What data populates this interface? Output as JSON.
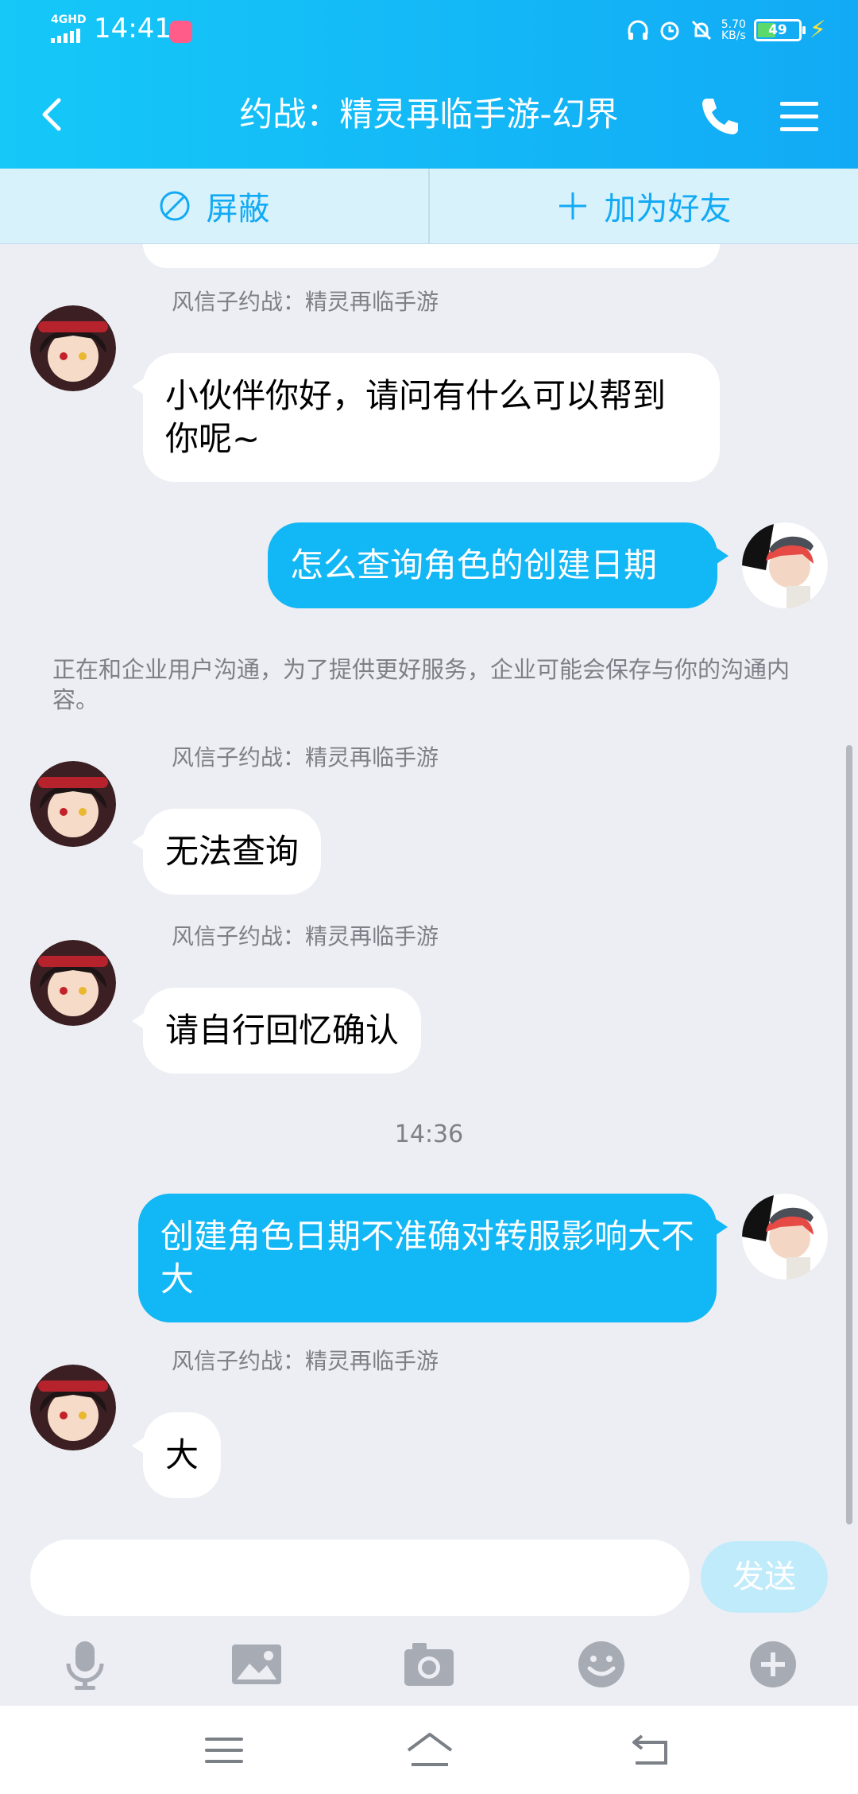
{
  "status_bar": {
    "network": "4GHD",
    "time": "14:41",
    "speed_value": "5.70",
    "speed_unit": "KB/s",
    "battery": "49",
    "battery_level": 0.49
  },
  "header": {
    "title": "约战：精灵再临手游-幻界"
  },
  "actions": {
    "block_label": "屏蔽",
    "add_friend_label": "加为好友"
  },
  "messages": [
    {
      "type": "incoming",
      "sender": "风信子约战：精灵再临手游",
      "text": "小伙伴你好，请问有什么可以帮到你呢~"
    },
    {
      "type": "outgoing",
      "text": "怎么查询角色的创建日期"
    },
    {
      "type": "notice",
      "text": "正在和企业用户沟通，为了提供更好服务，企业可能会保存与你的沟通内容。"
    },
    {
      "type": "incoming",
      "sender": "风信子约战：精灵再临手游",
      "text": "无法查询"
    },
    {
      "type": "incoming",
      "sender": "风信子约战：精灵再临手游",
      "text": "请自行回忆确认"
    },
    {
      "type": "time",
      "text": "14:36"
    },
    {
      "type": "outgoing",
      "text": "创建角色日期不准确对转服影响大不大"
    },
    {
      "type": "incoming",
      "sender": "风信子约战：精灵再临手游",
      "text": "大"
    }
  ],
  "input": {
    "placeholder": "",
    "send_label": "发送"
  },
  "colors": {
    "accent": "#12b7f5",
    "header_gradient_start": "#15c8f8",
    "header_gradient_end": "#12aaf5",
    "chat_background": "#eceef3",
    "action_bar": "#d8f2fb",
    "send_disabled": "#c0ebfb"
  },
  "icons": {
    "back": "chevron-left-icon",
    "phone": "phone-icon",
    "menu": "hamburger-menu-icon",
    "block": "block-icon",
    "add": "plus-icon",
    "tools": [
      "microphone-icon",
      "image-icon",
      "camera-icon",
      "emoji-icon",
      "plus-circle-icon"
    ],
    "nav": [
      "menu-icon",
      "home-icon",
      "back-icon"
    ]
  }
}
